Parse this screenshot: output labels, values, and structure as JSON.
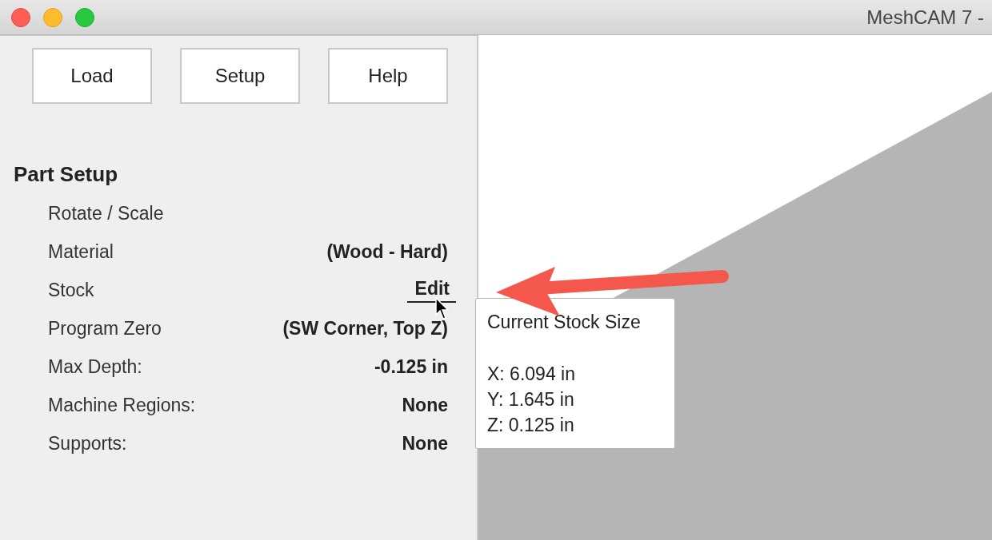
{
  "window": {
    "title": "MeshCAM 7 -"
  },
  "toolbar": [
    "Load",
    "Setup",
    "Help"
  ],
  "section": {
    "title": "Part Setup",
    "rows": [
      {
        "label": "Rotate / Scale"
      },
      {
        "label": "Material",
        "value": "(Wood - Hard)",
        "kind": "text"
      },
      {
        "label": "Stock",
        "value": "Edit",
        "kind": "link"
      },
      {
        "label": "Program Zero",
        "value": "(SW Corner, Top Z)",
        "kind": "text"
      },
      {
        "label": "Max Depth:",
        "value": "-0.125 in",
        "kind": "text"
      },
      {
        "label": "Machine Regions:",
        "value": "None",
        "kind": "text"
      },
      {
        "label": "Supports:",
        "value": "None",
        "kind": "text"
      }
    ]
  },
  "tooltip": {
    "title": "Current Stock Size",
    "lines": [
      "X: 6.094 in",
      "Y: 1.645 in",
      "Z: 0.125 in"
    ]
  }
}
